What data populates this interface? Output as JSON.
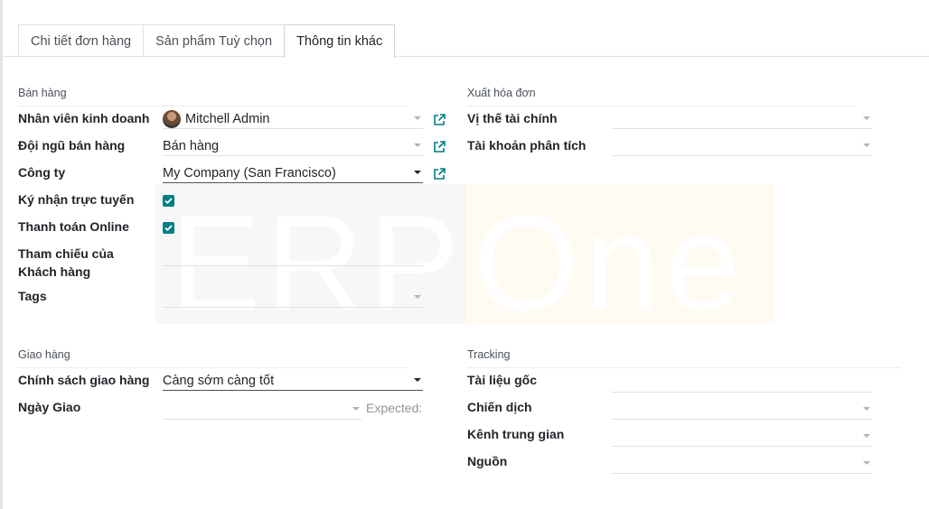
{
  "tabs": [
    {
      "label": "Chi tiết đơn hàng",
      "active": false
    },
    {
      "label": "Sản phẩm Tuỳ chọn",
      "active": false
    },
    {
      "label": "Thông tin khác",
      "active": true
    }
  ],
  "sales": {
    "title": "Bán hàng",
    "salesperson": {
      "label": "Nhân viên kinh doanh",
      "value": "Mitchell Admin"
    },
    "team": {
      "label": "Đội ngũ bán hàng",
      "value": "Bán hàng"
    },
    "company": {
      "label": "Công ty",
      "value": "My Company (San Francisco)"
    },
    "online_signature": {
      "label": "Ký nhận trực tuyến",
      "checked": true
    },
    "online_payment": {
      "label": "Thanh toán Online",
      "checked": true
    },
    "customer_reference": {
      "label": "Tham chiếu của Khách hàng",
      "value": ""
    },
    "tags": {
      "label": "Tags",
      "value": ""
    }
  },
  "invoicing": {
    "title": "Xuất hóa đơn",
    "fiscal_position": {
      "label": "Vị thế tài chính",
      "value": ""
    },
    "analytic_account": {
      "label": "Tài khoản phân tích",
      "value": ""
    }
  },
  "delivery": {
    "title": "Giao hàng",
    "shipping_policy": {
      "label": "Chính sách giao hàng",
      "value": "Càng sớm càng tốt"
    },
    "delivery_date": {
      "label": "Ngày Giao",
      "value": "",
      "expected_label": "Expected:"
    }
  },
  "tracking": {
    "title": "Tracking",
    "source_document": {
      "label": "Tài liệu gốc",
      "value": ""
    },
    "campaign": {
      "label": "Chiến dịch",
      "value": ""
    },
    "medium": {
      "label": "Kênh trung gian",
      "value": ""
    },
    "source": {
      "label": "Nguồn",
      "value": ""
    }
  },
  "watermark": {
    "left": "ERP",
    "right": "One"
  },
  "colors": {
    "accent": "#017e84",
    "link_icon": "#017e84"
  },
  "icons": {
    "external_link": "external-link-icon",
    "dropdown": "caret-down-icon",
    "checkbox": "checkmark-icon"
  }
}
